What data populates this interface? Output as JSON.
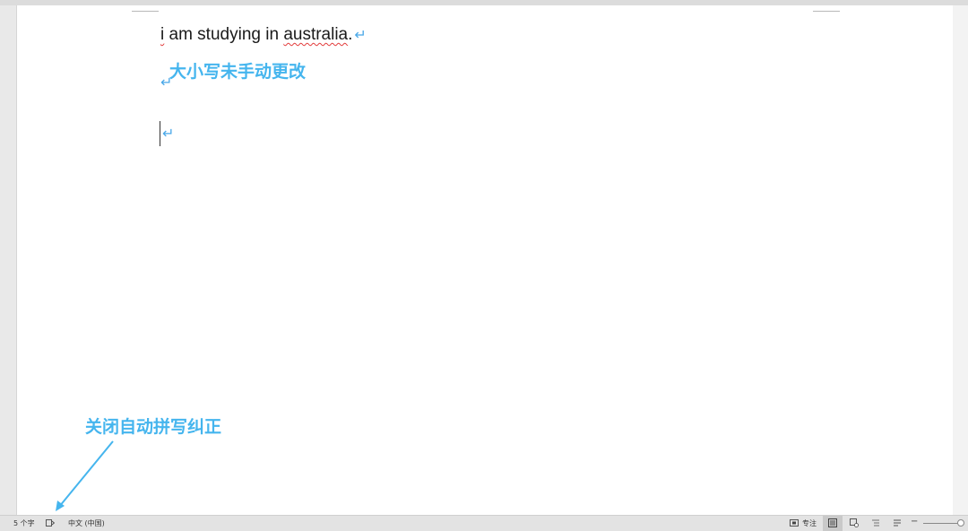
{
  "document": {
    "line1_text_a": "i",
    "line1_text_b": " am studying in ",
    "line1_text_c": "australia",
    "line1_text_d": ".",
    "paragraph_mark": "↵"
  },
  "annotations": {
    "top": "大小写未手动更改",
    "bottom": "关闭自动拼写纠正"
  },
  "statusbar": {
    "word_count": "5 个字",
    "language": "中文 (中国)",
    "focus_label": "专注",
    "zoom_minus": "−"
  },
  "colors": {
    "annotation": "#45b5ee",
    "paragraph_mark": "#4aa8e8",
    "spell_squiggle": "#e23b3b"
  },
  "icons": [
    "proofing-icon",
    "focus-icon",
    "print-layout-icon",
    "web-layout-icon",
    "outline-icon",
    "draft-icon"
  ]
}
